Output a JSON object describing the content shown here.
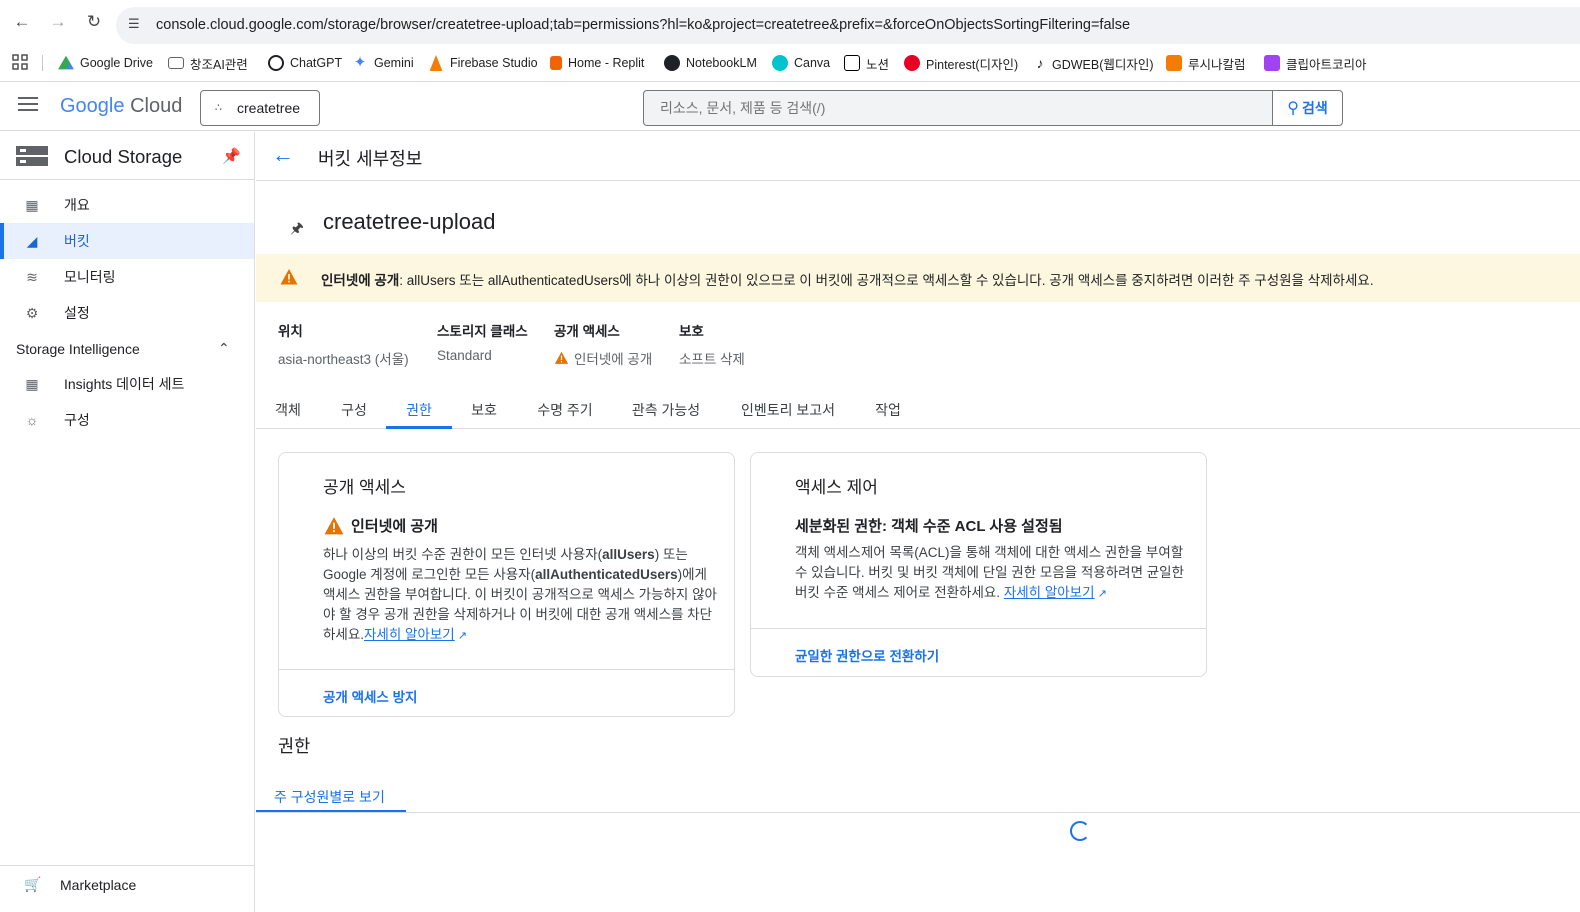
{
  "browser": {
    "url": "console.cloud.google.com/storage/browser/createtree-upload;tab=permissions?hl=ko&project=createtree&prefix=&forceOnObjectsSortingFiltering=false"
  },
  "bookmarks": [
    {
      "label": "Google Drive",
      "icon": "google-drive-icon",
      "color": "#34a853"
    },
    {
      "label": "창조AI관련",
      "icon": "folder-icon",
      "color": "#5f6368"
    },
    {
      "label": "ChatGPT",
      "icon": "chatgpt-icon",
      "color": "#202124"
    },
    {
      "label": "Gemini",
      "icon": "gemini-icon",
      "color": "#4285f4"
    },
    {
      "label": "Firebase Studio",
      "icon": "firebase-icon",
      "color": "#f57c00"
    },
    {
      "label": "Home - Replit",
      "icon": "replit-icon",
      "color": "#f26207"
    },
    {
      "label": "NotebookLM",
      "icon": "notebooklm-icon",
      "color": "#202124"
    },
    {
      "label": "Canva",
      "icon": "canva-icon",
      "color": "#00c4cc"
    },
    {
      "label": "노션",
      "icon": "notion-icon",
      "color": "#000000"
    },
    {
      "label": "Pinterest(디자인)",
      "icon": "pinterest-icon",
      "color": "#e60023"
    },
    {
      "label": "GDWEB(웹디자인)",
      "icon": "tiktok-icon",
      "color": "#000000"
    },
    {
      "label": "루시나칼럼",
      "icon": "lucina-icon",
      "color": "#f57c00"
    },
    {
      "label": "클립아트코리아",
      "icon": "clipart-icon",
      "color": "#a142f4"
    }
  ],
  "header": {
    "logo_google": "Google",
    "logo_cloud": "Cloud",
    "project": "createtree",
    "search_placeholder": "리소스, 문서, 제품 등 검색(/)",
    "search_button": "검색"
  },
  "sidebar": {
    "title": "Cloud Storage",
    "items": [
      {
        "label": "개요",
        "icon": "overview-icon"
      },
      {
        "label": "버킷",
        "icon": "bucket-icon",
        "active": true
      },
      {
        "label": "모니터링",
        "icon": "monitoring-icon"
      },
      {
        "label": "설정",
        "icon": "settings-icon"
      }
    ],
    "section": "Storage Intelligence",
    "section_items": [
      {
        "label": "Insights 데이터 세트",
        "icon": "dataset-icon"
      },
      {
        "label": "구성",
        "icon": "config-icon"
      }
    ],
    "marketplace": "Marketplace"
  },
  "page": {
    "title": "버킷 세부정보",
    "bucket_name": "createtree-upload",
    "warning_bold": "인터넷에 공개",
    "warning_text": ": allUsers 또는 allAuthenticatedUsers에 하나 이상의 권한이 있으므로 이 버킷에 공개적으로 액세스할 수 있습니다. 공개 액세스를 중지하려면 이러한 주 구성원을 삭제하세요.",
    "meta": [
      {
        "key": "위치",
        "value": "asia-northeast3 (서울)"
      },
      {
        "key": "스토리지 클래스",
        "value": "Standard"
      },
      {
        "key": "공개 액세스",
        "value": "인터넷에 공개"
      },
      {
        "key": "보호",
        "value": "소프트 삭제"
      }
    ],
    "tabs": [
      "객체",
      "구성",
      "권한",
      "보호",
      "수명 주기",
      "관측 가능성",
      "인벤토리 보고서",
      "작업"
    ],
    "active_tab": "권한"
  },
  "public_access_card": {
    "title": "공개 액세스",
    "status": "인터넷에 공개",
    "body_1": "하나 이상의 버킷 수준 권한이 모든 인터넷 사용자(",
    "body_bold_1": "allUsers",
    "body_2": ") 또는 Google 계정에 로그인한 모든 사용자(",
    "body_bold_2": "allAuthenticatedUsers",
    "body_3": ")에게 액세스 권한을 부여합니다. 이 버킷이 공개적으로 액세스 가능하지 않아야 할 경우 공개 권한을 삭제하거나 이 버킷에 대한 공개 액세스를 차단하세요.",
    "link": "자세히 알아보기",
    "action": "공개 액세스 방지"
  },
  "access_control_card": {
    "title": "액세스 제어",
    "status": "세분화된 권한: 객체 수준 ACL 사용 설정됨",
    "body": "객체 액세스제어 목록(ACL)을 통해 객체에 대한 액세스 권한을 부여할 수 있습니다. 버킷 및 버킷 객체에 단일 권한 모음을 적용하려면 균일한 버킷 수준 액세스 제어로 전환하세요. ",
    "link": "자세히 알아보기",
    "action": "균일한 권한으로 전환하기"
  },
  "permissions": {
    "title": "권한",
    "subtab": "주 구성원별로 보기"
  },
  "colors": {
    "accent": "#1a73e8",
    "warning": "#e37400",
    "warning_bg": "#fef7e0"
  }
}
